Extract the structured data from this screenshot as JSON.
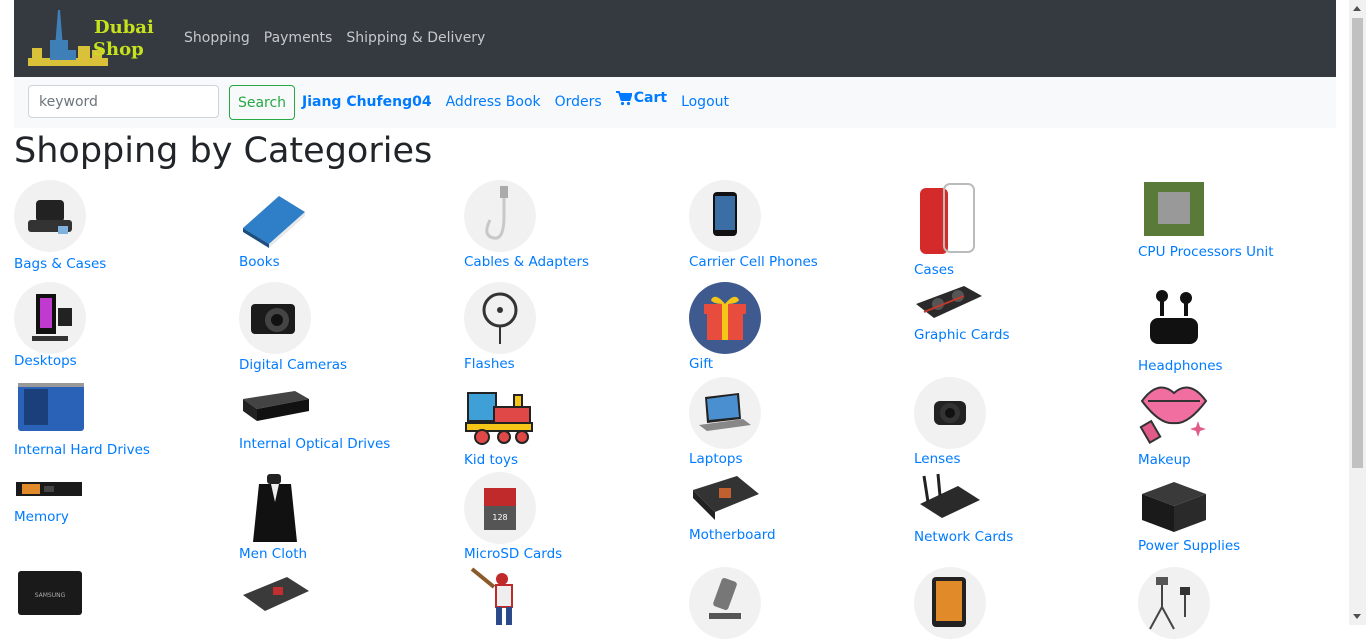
{
  "brand": {
    "line1": "Dubai",
    "line2": "Shop"
  },
  "nav": [
    "Shopping",
    "Payments",
    "Shipping & Delivery"
  ],
  "search": {
    "placeholder": "keyword",
    "button": "Search"
  },
  "user": {
    "name": "Jiang Chufeng04",
    "address_book": "Address Book",
    "orders": "Orders",
    "cart": "Cart",
    "logout": "Logout"
  },
  "heading": "Shopping by Categories",
  "categories": [
    {
      "label": "Bags & Cases",
      "icon": "bag-icon"
    },
    {
      "label": "Books",
      "icon": "book-icon"
    },
    {
      "label": "Cables & Adapters",
      "icon": "cable-icon"
    },
    {
      "label": "Carrier Cell Phones",
      "icon": "phone-icon"
    },
    {
      "label": "Cases",
      "icon": "phone-case-icon"
    },
    {
      "label": "CPU Processors Unit",
      "icon": "cpu-icon"
    },
    {
      "label": "Desktops",
      "icon": "desktop-icon"
    },
    {
      "label": "Digital Cameras",
      "icon": "camera-icon"
    },
    {
      "label": "Flashes",
      "icon": "ring-light-icon"
    },
    {
      "label": "Gift",
      "icon": "gift-icon"
    },
    {
      "label": "Graphic Cards",
      "icon": "gpu-icon"
    },
    {
      "label": "Headphones",
      "icon": "earbuds-icon"
    },
    {
      "label": "Internal Hard Drives",
      "icon": "hard-drive-icon"
    },
    {
      "label": "Internal Optical Drives",
      "icon": "optical-drive-icon"
    },
    {
      "label": "Kid toys",
      "icon": "toy-train-icon"
    },
    {
      "label": "Laptops",
      "icon": "laptop-icon"
    },
    {
      "label": "Lenses",
      "icon": "lens-icon"
    },
    {
      "label": "Makeup",
      "icon": "lips-icon"
    },
    {
      "label": "Memory",
      "icon": "memory-icon"
    },
    {
      "label": "Men Cloth",
      "icon": "suit-icon"
    },
    {
      "label": "MicroSD Cards",
      "icon": "sd-card-icon"
    },
    {
      "label": "Motherboard",
      "icon": "motherboard-icon"
    },
    {
      "label": "Network Cards",
      "icon": "network-card-icon"
    },
    {
      "label": "Power Supplies",
      "icon": "power-supply-icon"
    },
    {
      "label": "",
      "icon": "ssd-icon"
    },
    {
      "label": "",
      "icon": "sound-card-icon"
    },
    {
      "label": "",
      "icon": "baseball-player-icon"
    },
    {
      "label": "",
      "icon": "phone-stand-icon"
    },
    {
      "label": "",
      "icon": "tablet-icon"
    },
    {
      "label": "",
      "icon": "tripod-icon"
    }
  ]
}
